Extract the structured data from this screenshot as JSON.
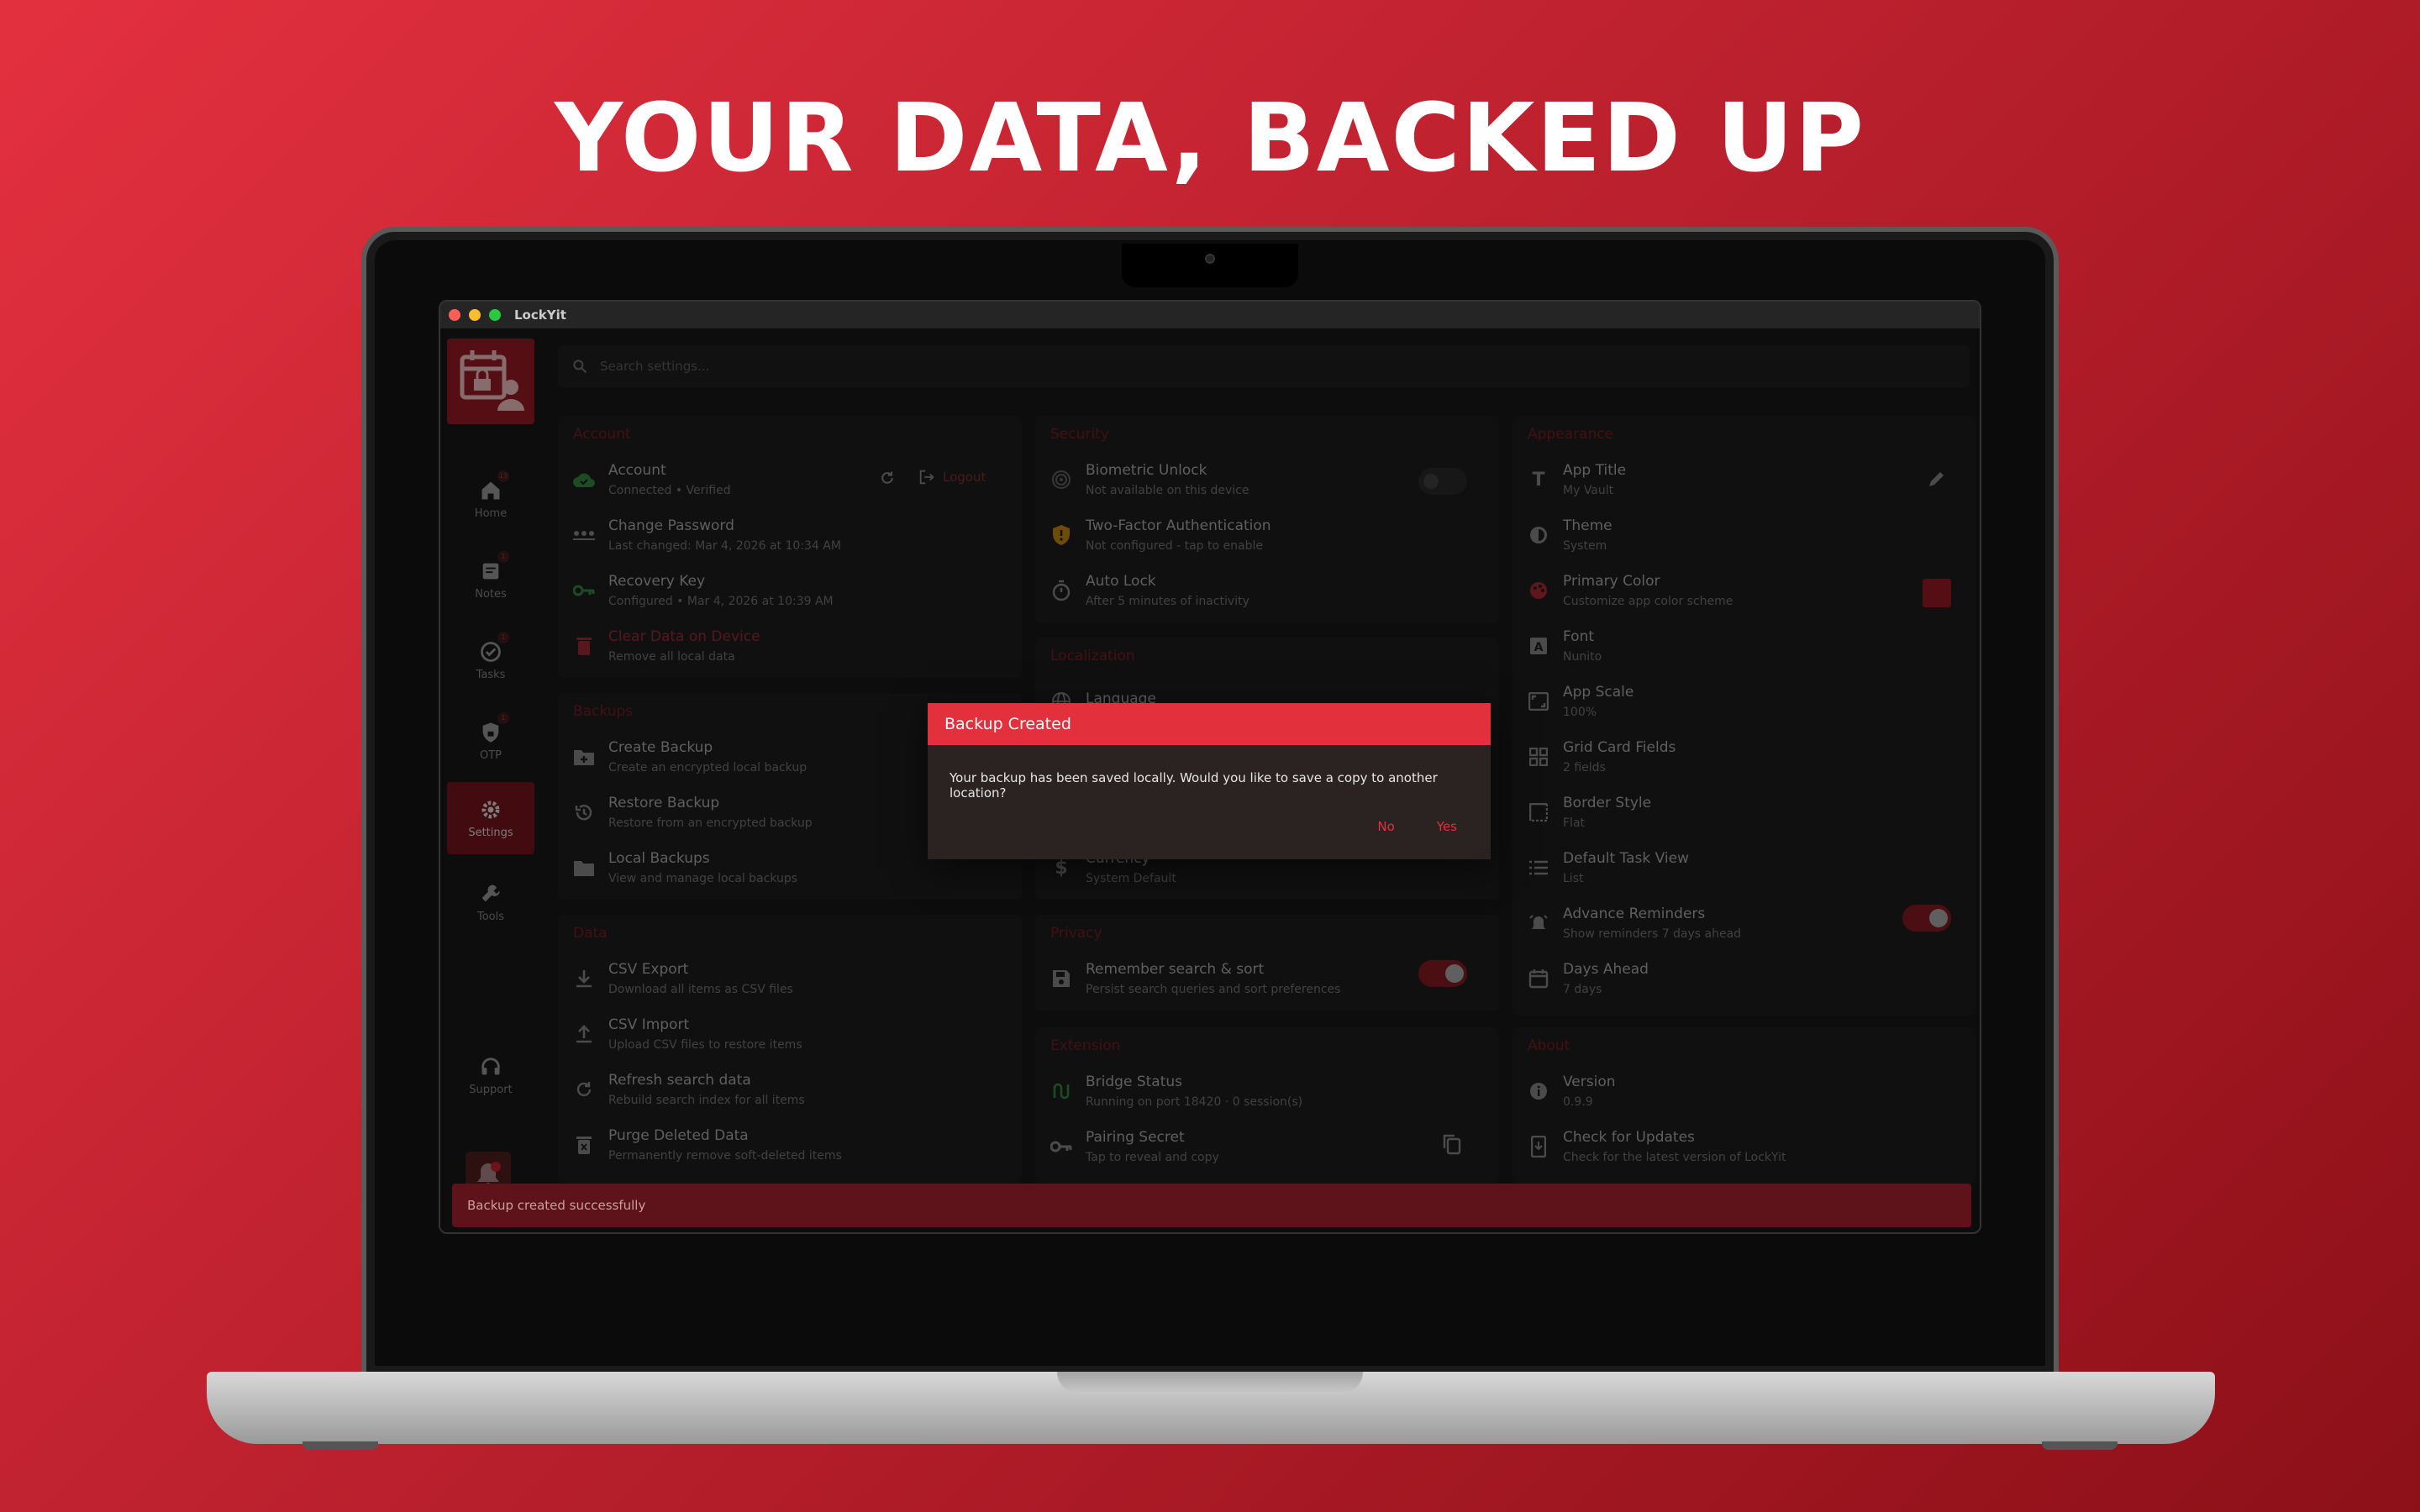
{
  "headline": "YOUR DATA, BACKED UP",
  "window": {
    "title": "LockYit"
  },
  "search": {
    "placeholder": "Search settings..."
  },
  "sidebar": {
    "items": [
      {
        "label": "Home",
        "icon": "home-icon"
      },
      {
        "label": "Notes",
        "icon": "notes-icon"
      },
      {
        "label": "Tasks",
        "icon": "tasks-icon"
      },
      {
        "label": "OTP",
        "icon": "otp-shield-icon"
      },
      {
        "label": "Settings",
        "icon": "gear-icon",
        "active": true
      },
      {
        "label": "Tools",
        "icon": "wrench-icon"
      },
      {
        "label": "Support",
        "icon": "headset-icon"
      }
    ]
  },
  "account": {
    "title": "Account",
    "items": [
      {
        "label": "Account",
        "sub": "Connected • Verified"
      },
      {
        "label": "Change Password",
        "sub": "Last changed: Mar 4, 2026 at 10:34 AM"
      },
      {
        "label": "Recovery Key",
        "sub": "Configured • Mar 4, 2026 at 10:39 AM"
      },
      {
        "label": "Clear Data on Device",
        "sub": "Remove all local data"
      }
    ],
    "logout_label": "Logout"
  },
  "backups": {
    "title": "Backups",
    "items": [
      {
        "label": "Create Backup",
        "sub": "Create an encrypted local backup"
      },
      {
        "label": "Restore Backup",
        "sub": "Restore from an encrypted backup"
      },
      {
        "label": "Local Backups",
        "sub": "View and manage local backups"
      }
    ]
  },
  "data_section": {
    "title": "Data",
    "items": [
      {
        "label": "CSV Export",
        "sub": "Download all items as CSV files"
      },
      {
        "label": "CSV Import",
        "sub": "Upload CSV files to restore items"
      },
      {
        "label": "Refresh search data",
        "sub": "Rebuild search index for all items"
      },
      {
        "label": "Purge Deleted Data",
        "sub": "Permanently remove soft-deleted items"
      }
    ]
  },
  "security": {
    "title": "Security",
    "items": [
      {
        "label": "Biometric Unlock",
        "sub": "Not available on this device"
      },
      {
        "label": "Two-Factor Authentication",
        "sub": "Not configured - tap to enable"
      },
      {
        "label": "Auto Lock",
        "sub": "After 5 minutes of inactivity"
      }
    ]
  },
  "localization": {
    "title": "Localization",
    "items": [
      {
        "label": "Language",
        "sub": ""
      },
      {
        "label": "Currency",
        "sub": "System Default"
      }
    ]
  },
  "privacy": {
    "title": "Privacy",
    "items": [
      {
        "label": "Remember search & sort",
        "sub": "Persist search queries and sort preferences"
      }
    ]
  },
  "extension": {
    "title": "Extension",
    "items": [
      {
        "label": "Bridge Status",
        "sub": "Running on port 18420 · 0 session(s)"
      },
      {
        "label": "Pairing Secret",
        "sub": "Tap to reveal and copy"
      }
    ]
  },
  "appearance": {
    "title": "Appearance",
    "items": [
      {
        "label": "App Title",
        "sub": "My Vault"
      },
      {
        "label": "Theme",
        "sub": "System"
      },
      {
        "label": "Primary Color",
        "sub": "Customize app color scheme"
      },
      {
        "label": "Font",
        "sub": "Nunito"
      },
      {
        "label": "App Scale",
        "sub": "100%"
      },
      {
        "label": "Grid Card Fields",
        "sub": "2 fields"
      },
      {
        "label": "Border Style",
        "sub": "Flat"
      },
      {
        "label": "Default Task View",
        "sub": "List"
      },
      {
        "label": "Advance Reminders",
        "sub": "Show reminders 7 days ahead"
      },
      {
        "label": "Days Ahead",
        "sub": "7 days"
      }
    ],
    "primary_color": "#8a1820"
  },
  "about": {
    "title": "About",
    "items": [
      {
        "label": "Version",
        "sub": "0.9.9"
      },
      {
        "label": "Check for Updates",
        "sub": "Check for the latest version of LockYit"
      }
    ]
  },
  "dialog": {
    "title": "Backup Created",
    "message": "Your backup has been saved locally. Would you like to save a copy to another location?",
    "no_label": "No",
    "yes_label": "Yes"
  },
  "snackbar": {
    "message": "Backup created successfully"
  },
  "colors": {
    "accent": "#e2303d",
    "toggle_on": "#b0202c"
  }
}
